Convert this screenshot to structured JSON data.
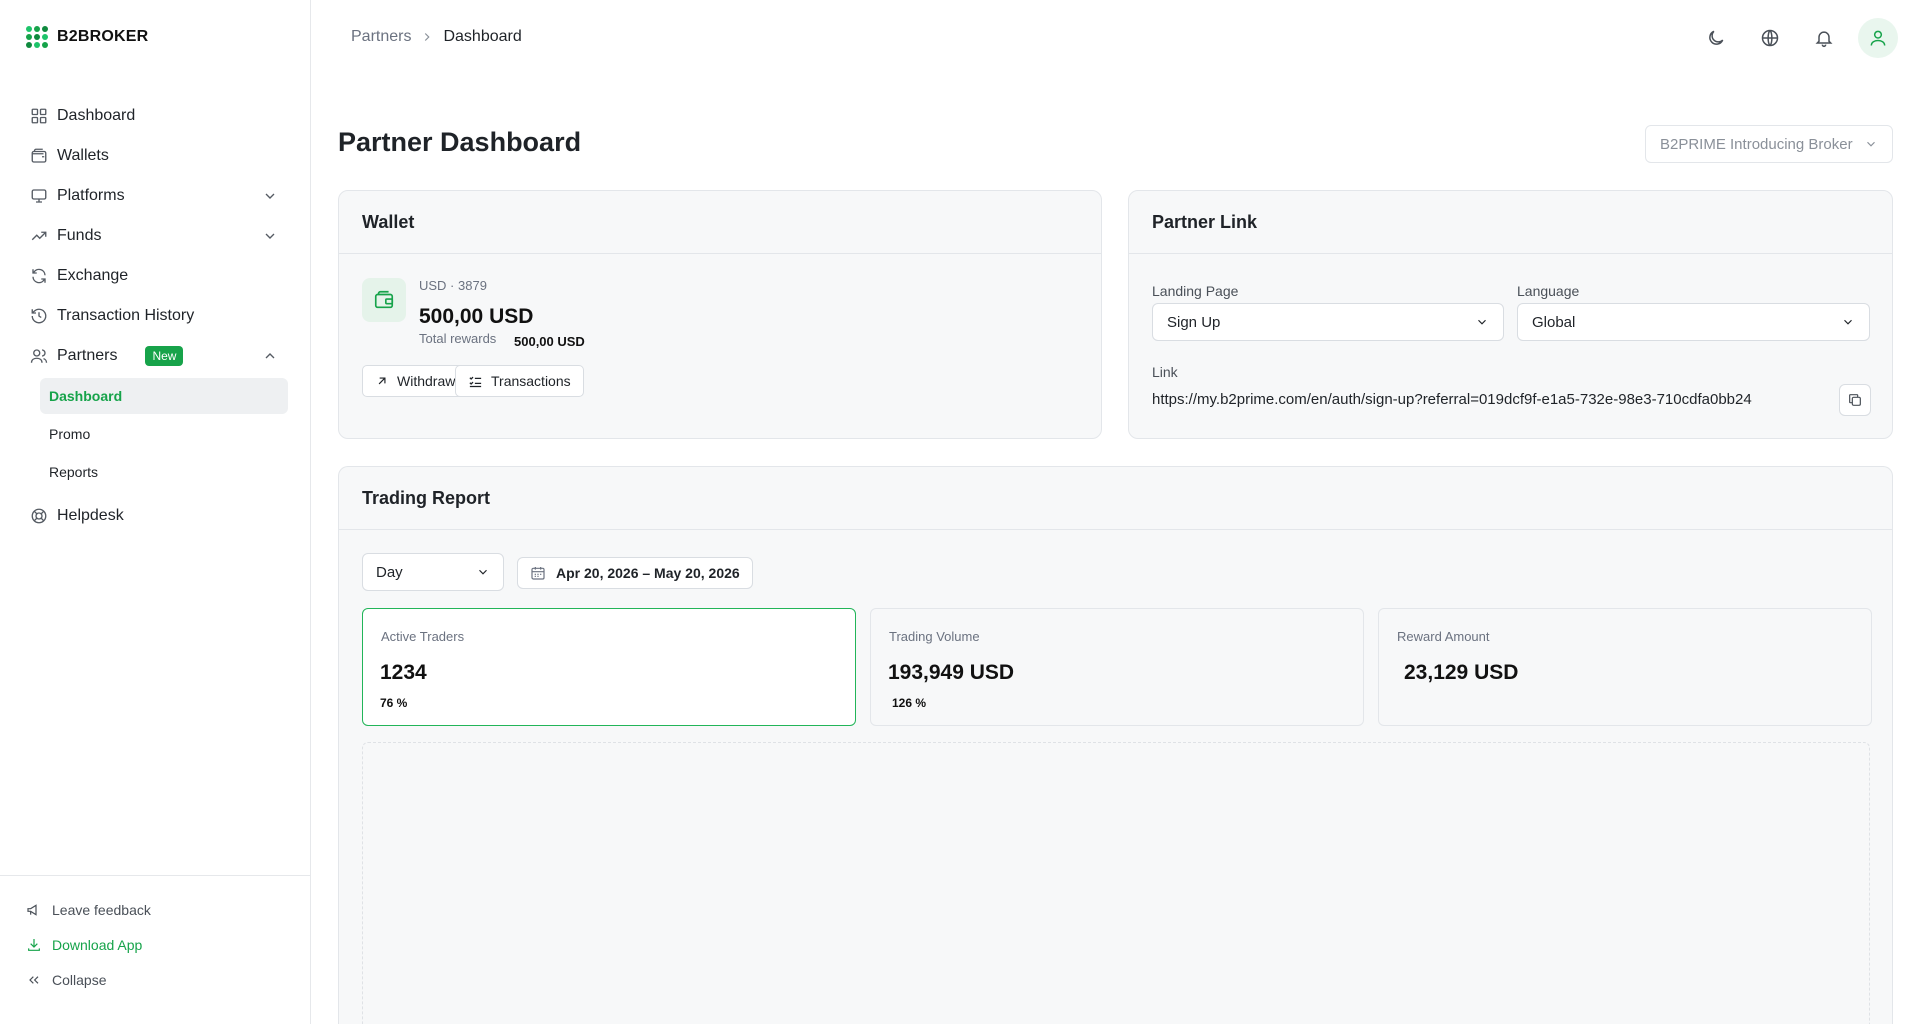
{
  "app": {
    "logo_text": "B2BROKER"
  },
  "sidebar": {
    "items": [
      {
        "label": "Dashboard",
        "icon": "grid-icon"
      },
      {
        "label": "Wallets",
        "icon": "wallet-icon"
      },
      {
        "label": "Platforms",
        "icon": "monitor-icon",
        "expandable": true
      },
      {
        "label": "Funds",
        "icon": "trending-up-icon",
        "expandable": true
      },
      {
        "label": "Exchange",
        "icon": "refresh-icon"
      },
      {
        "label": "Transaction History",
        "icon": "history-icon"
      },
      {
        "label": "Partners",
        "icon": "users-icon",
        "badge": "New",
        "expanded": true
      },
      {
        "label": "Helpdesk",
        "icon": "lifebuoy-icon"
      }
    ],
    "partners_sub": [
      {
        "label": "Dashboard",
        "active": true
      },
      {
        "label": "Promo"
      },
      {
        "label": "Reports"
      }
    ],
    "footer": {
      "feedback": "Leave feedback",
      "download": "Download App",
      "collapse": "Collapse"
    }
  },
  "header": {
    "breadcrumb_parent": "Partners",
    "breadcrumb_current": "Dashboard"
  },
  "page": {
    "title": "Partner Dashboard",
    "broker_select": "B2PRIME Introducing Broker"
  },
  "wallet": {
    "title": "Wallet",
    "account": "USD · 3879",
    "balance": "500,00 USD",
    "total_rewards_label": "Total rewards",
    "total_rewards_value": "500,00 USD",
    "withdraw_label": "Withdraw",
    "transactions_label": "Transactions"
  },
  "partner_link": {
    "title": "Partner Link",
    "landing_label": "Landing Page",
    "landing_value": "Sign Up",
    "language_label": "Language",
    "language_value": "Global",
    "link_label": "Link",
    "link_value": "https://my.b2prime.com/en/auth/sign-up?referral=019dcf9f-e1a5-732e-98e3-710cdfa0bb24"
  },
  "trading_report": {
    "title": "Trading Report",
    "period": "Day",
    "date_range": "Apr 20, 2026 – May 20, 2026",
    "metrics": [
      {
        "label": "Active Traders",
        "value": "1234",
        "pct": "76 %",
        "active": true
      },
      {
        "label": "Trading Volume",
        "value": "193,949 USD",
        "pct": "126 %"
      },
      {
        "label": "Reward Amount",
        "value": "23,129 USD",
        "pct": ""
      }
    ]
  },
  "colors": {
    "accent": "#16a34a",
    "badge": "#17a34a",
    "card_bg": "#f7f8f9",
    "border": "#e3e6ea"
  }
}
